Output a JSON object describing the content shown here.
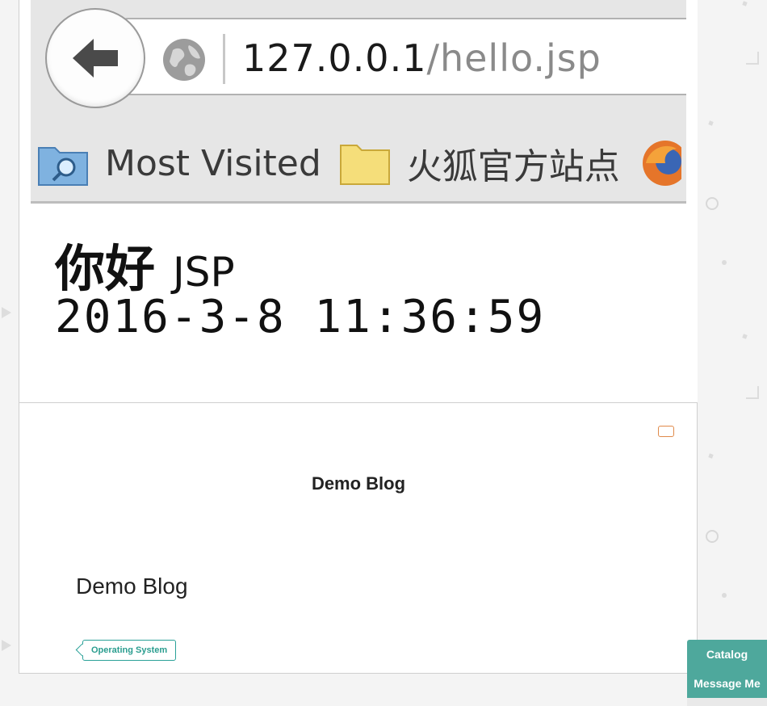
{
  "browser": {
    "url_host": "127.0.0.1",
    "url_path": "/hello.jsp",
    "bookmarks": [
      {
        "label": "Most Visited",
        "icon": "folder-search-icon"
      },
      {
        "label": "火狐官方站点",
        "icon": "folder-icon"
      }
    ]
  },
  "page": {
    "hello_big": "你好",
    "hello_small": "JSP",
    "date": "2016-3-8 11:36:59"
  },
  "post": {
    "title": "Demo Blog",
    "body_title": "Demo Blog",
    "tag": "Operating System"
  },
  "float_menu": {
    "catalog": "Catalog",
    "message": "Message Me"
  },
  "colors": {
    "accent": "#4ea89c",
    "tag": "#2a9d8f",
    "badge": "#e08a4a"
  }
}
